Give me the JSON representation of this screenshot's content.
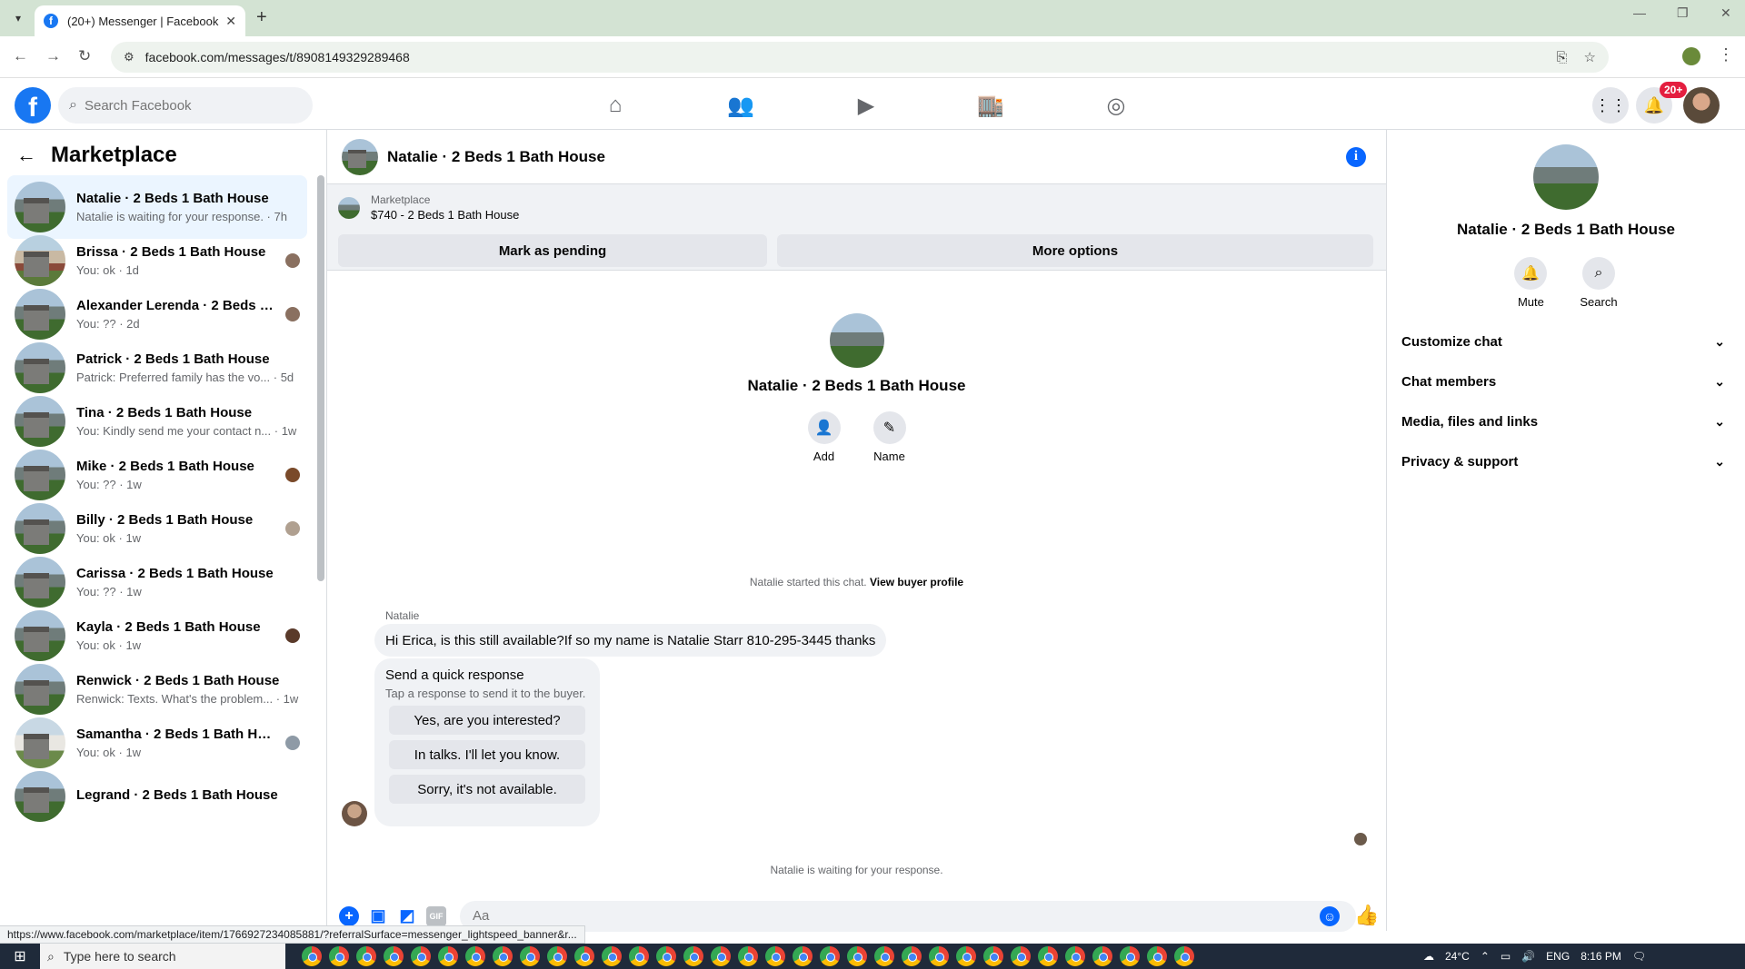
{
  "browser": {
    "tab_title": "(20+) Messenger | Facebook",
    "url": "facebook.com/messages/t/8908149329289468",
    "status_url": "https://www.facebook.com/marketplace/item/1766927234085881/?referralSurface=messenger_lightspeed_banner&r..."
  },
  "fb": {
    "search_placeholder": "Search Facebook",
    "notification_badge": "20+"
  },
  "sidebar": {
    "title": "Marketplace",
    "chats": [
      {
        "name": "Natalie · 2 Beds 1 Bath House",
        "preview": "Natalie is waiting for your response. · 7h"
      },
      {
        "name": "Brissa · 2 Beds 1 Bath House",
        "preview": "You: ok · 1d"
      },
      {
        "name": "Alexander Lerenda · 2 Beds 1 ...",
        "preview": "You: ?? · 2d"
      },
      {
        "name": "Patrick · 2 Beds 1 Bath House",
        "preview": "Patrick: Preferred family has the vo... · 5d"
      },
      {
        "name": "Tina · 2 Beds 1 Bath House",
        "preview": "You: Kindly send me your contact n... · 1w"
      },
      {
        "name": "Mike · 2 Beds 1 Bath House",
        "preview": "You: ?? · 1w"
      },
      {
        "name": "Billy · 2 Beds 1 Bath House",
        "preview": "You: ok · 1w"
      },
      {
        "name": "Carissa · 2 Beds 1 Bath House",
        "preview": "You: ?? · 1w"
      },
      {
        "name": "Kayla · 2 Beds 1 Bath House",
        "preview": "You: ok · 1w"
      },
      {
        "name": "Renwick · 2 Beds 1 Bath House",
        "preview": "Renwick: Texts. What's the problem... · 1w"
      },
      {
        "name": "Samantha · 2 Beds 1 Bath Hou...",
        "preview": "You: ok · 1w"
      },
      {
        "name": "Legrand · 2 Beds 1 Bath House",
        "preview": ""
      }
    ]
  },
  "conversation": {
    "title": "Natalie · 2 Beds 1 Bath House",
    "listing_source": "Marketplace",
    "listing_price": "$740 - 2 Beds 1 Bath House",
    "mark_pending": "Mark as pending",
    "more_options": "More options",
    "profile_name": "Natalie · 2 Beds 1 Bath House",
    "add_label": "Add",
    "name_label": "Name",
    "started_text": "Natalie started this chat.",
    "view_profile": "View buyer profile",
    "sender": "Natalie",
    "message": "Hi Erica, is this still available?If so my name is Natalie Starr 810-295-3445 thanks",
    "quick_title": "Send a quick response",
    "quick_subtitle": "Tap a response to send it to the buyer.",
    "quick_responses": [
      "Yes, are you interested?",
      "In talks. I'll let you know.",
      "Sorry, it's not available."
    ],
    "waiting_text": "Natalie is waiting for your response.",
    "input_placeholder": "Aa"
  },
  "info_panel": {
    "name": "Natalie · 2 Beds 1 Bath House",
    "mute_label": "Mute",
    "search_label": "Search",
    "sections": [
      "Customize chat",
      "Chat members",
      "Media, files and links",
      "Privacy & support"
    ]
  },
  "taskbar": {
    "search_placeholder": "Type here to search",
    "temperature": "24°C",
    "language": "ENG",
    "time": "8:16 PM"
  }
}
